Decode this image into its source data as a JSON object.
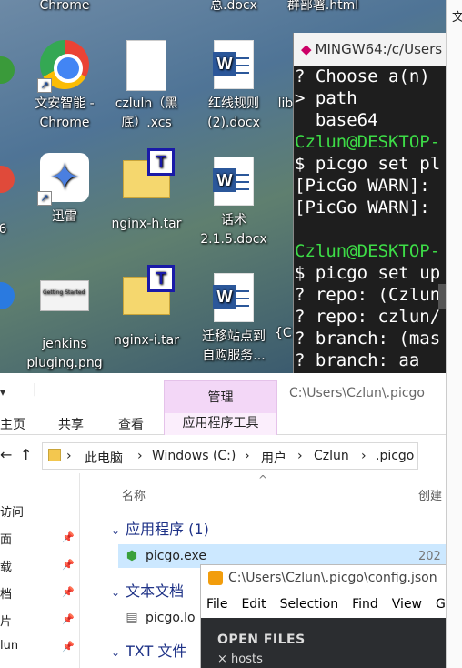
{
  "desktop": {
    "top_labels": [
      {
        "text": "Chrome"
      },
      {
        "text": "总.docx"
      },
      {
        "text": "群部署.html"
      }
    ],
    "icons": [
      {
        "label": "文安智能 -\nChrome",
        "icon": "chrome-icon"
      },
      {
        "label": "czluln（黑\n底）.xcs",
        "icon": "file-icon"
      },
      {
        "label": "红线规则\n(2).docx",
        "icon": "word-icon"
      },
      {
        "label": "lib",
        "icon": "file-icon"
      },
      {
        "label": "6",
        "icon": "app-icon"
      },
      {
        "label": "迅雷",
        "icon": "thunder-icon"
      },
      {
        "label": "nginx-h.tar",
        "icon": "archive-icon"
      },
      {
        "label": "话术\n2.1.5.docx",
        "icon": "word-icon"
      },
      {
        "label": "jenkins\npluging.png",
        "icon": "image-icon"
      },
      {
        "label": "nginx-i.tar",
        "icon": "archive-icon"
      },
      {
        "label": "迁移站点到\n自购服务...",
        "icon": "word-icon"
      },
      {
        "label": "{C",
        "icon": "file-icon"
      }
    ]
  },
  "terminal": {
    "title": "MINGW64:/c/Users",
    "lines": [
      {
        "text": "? Choose a(n) ",
        "color": "white"
      },
      {
        "text": "> path",
        "color": "white"
      },
      {
        "text": "  base64",
        "color": "white"
      },
      {
        "text": "Czlun@DESKTOP-",
        "color": "green"
      },
      {
        "text": "$ picgo set pl",
        "color": "white"
      },
      {
        "text": "[PicGo WARN]: ",
        "color": "white"
      },
      {
        "text": "[PicGo WARN]: ",
        "color": "white"
      },
      {
        "text": "",
        "color": "white"
      },
      {
        "text": "Czlun@DESKTOP-",
        "color": "green"
      },
      {
        "text": "$ picgo set up",
        "color": "white"
      },
      {
        "text": "? repo: (Czlun",
        "color": "white"
      },
      {
        "text": "? repo: czlun/",
        "color": "white"
      },
      {
        "text": "? branch: (mas",
        "color": "white"
      },
      {
        "text": "? branch: aa",
        "color": "white"
      }
    ]
  },
  "right_window": {
    "label": "文"
  },
  "explorer": {
    "quick_access_label": "",
    "context_tab": "管理",
    "title_path": "C:\\Users\\Czlun\\.picgo",
    "tabs": [
      "主页",
      "共享",
      "查看"
    ],
    "context_tools": "应用程序工具",
    "nav_back": "←",
    "nav_up": "↑",
    "breadcrumb": [
      "此电脑",
      "Windows (C:)",
      "用户",
      "Czlun",
      ".picgo"
    ],
    "breadcrumb_sep": "›",
    "sidebar": [
      "访问",
      "面",
      "载",
      "档",
      "片",
      "lun"
    ],
    "columns": {
      "name": "名称",
      "created": "创建"
    },
    "groups": [
      {
        "title": "应用程序 (1)",
        "files": [
          {
            "name": "picgo.exe",
            "date": "202"
          }
        ]
      },
      {
        "title": "文本文档",
        "files": [
          {
            "name": "picgo.lo",
            "date": ""
          }
        ]
      },
      {
        "title": "TXT 文件",
        "files": []
      }
    ]
  },
  "sublime": {
    "title": "C:\\Users\\Czlun\\.picgo\\config.json",
    "menu": [
      "File",
      "Edit",
      "Selection",
      "Find",
      "View",
      "G"
    ],
    "sidebar_header": "OPEN FILES",
    "open_files": [
      "hosts"
    ]
  },
  "colors": {
    "terminal_bg": "#1e1e1e",
    "terminal_prompt_green": "#3ddc47",
    "ribbon_manage": "#f3d7f7",
    "selection": "#cce8ff",
    "sublime_sidebar": "#2b2d30"
  }
}
